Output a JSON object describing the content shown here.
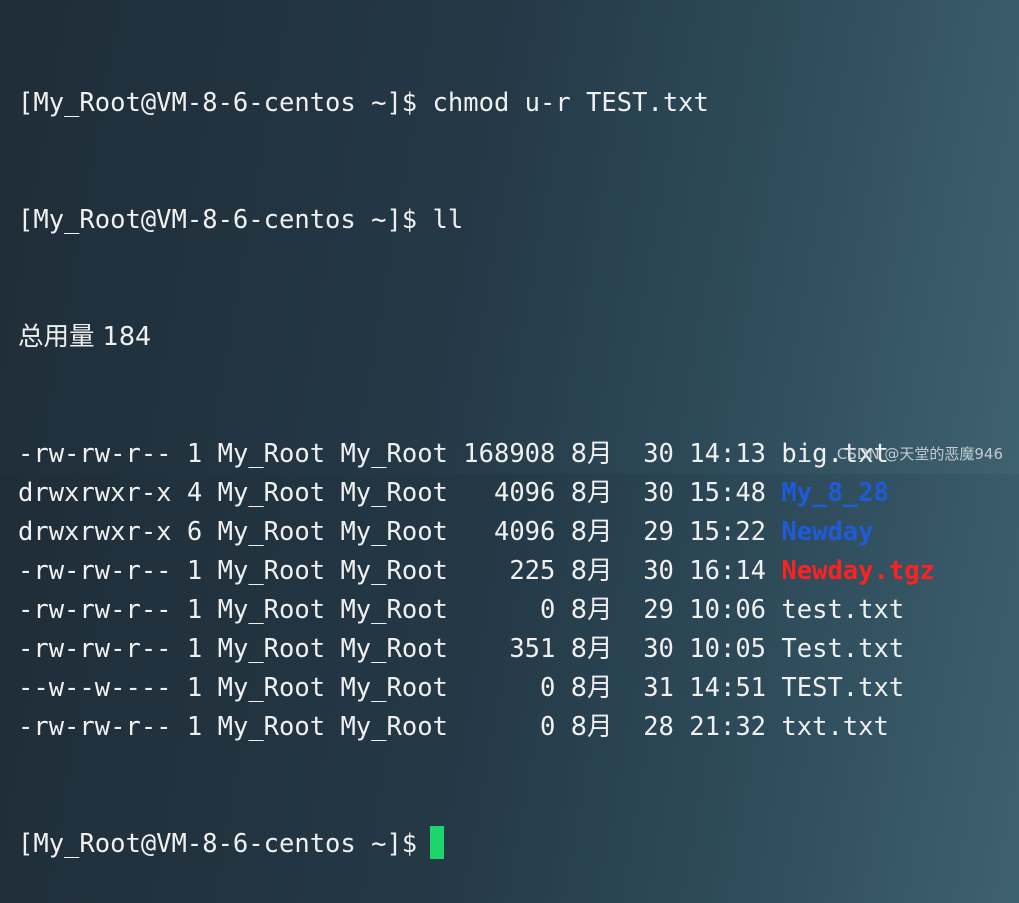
{
  "terminal": {
    "prompt": "[My_Root@VM-8-6-centos ~]$",
    "commands": [
      "chmod u-r TEST.txt",
      "ll"
    ],
    "total_line": "总用量 184",
    "listing": [
      {
        "perms": "-rw-rw-r--",
        "links": "1",
        "owner": "My_Root",
        "group": "My_Root",
        "size": "168908",
        "month": "8月",
        "day": "30",
        "time": "14:13",
        "name": "big.txt",
        "kind": "file"
      },
      {
        "perms": "drwxrwxr-x",
        "links": "4",
        "owner": "My_Root",
        "group": "My_Root",
        "size": "4096",
        "month": "8月",
        "day": "30",
        "time": "15:48",
        "name": "My_8_28",
        "kind": "directory"
      },
      {
        "perms": "drwxrwxr-x",
        "links": "6",
        "owner": "My_Root",
        "group": "My_Root",
        "size": "4096",
        "month": "8月",
        "day": "29",
        "time": "15:22",
        "name": "Newday",
        "kind": "directory"
      },
      {
        "perms": "-rw-rw-r--",
        "links": "1",
        "owner": "My_Root",
        "group": "My_Root",
        "size": "225",
        "month": "8月",
        "day": "30",
        "time": "16:14",
        "name": "Newday.tgz",
        "kind": "archive"
      },
      {
        "perms": "-rw-rw-r--",
        "links": "1",
        "owner": "My_Root",
        "group": "My_Root",
        "size": "0",
        "month": "8月",
        "day": "29",
        "time": "10:06",
        "name": "test.txt",
        "kind": "file"
      },
      {
        "perms": "-rw-rw-r--",
        "links": "1",
        "owner": "My_Root",
        "group": "My_Root",
        "size": "351",
        "month": "8月",
        "day": "30",
        "time": "10:05",
        "name": "Test.txt",
        "kind": "file"
      },
      {
        "perms": "--w--w----",
        "links": "1",
        "owner": "My_Root",
        "group": "My_Root",
        "size": "0",
        "month": "8月",
        "day": "31",
        "time": "14:51",
        "name": "TEST.txt",
        "kind": "file"
      },
      {
        "perms": "-rw-rw-r--",
        "links": "1",
        "owner": "My_Root",
        "group": "My_Root",
        "size": "0",
        "month": "8月",
        "day": "28",
        "time": "21:32",
        "name": "txt.txt",
        "kind": "file"
      }
    ],
    "cursor_color": "#1cd56b"
  },
  "colors": {
    "text": "#f0f0f0",
    "directory": "#1f5bd8",
    "archive": "#ff2020"
  },
  "watermark": "CSDN @天堂的恶魔946"
}
